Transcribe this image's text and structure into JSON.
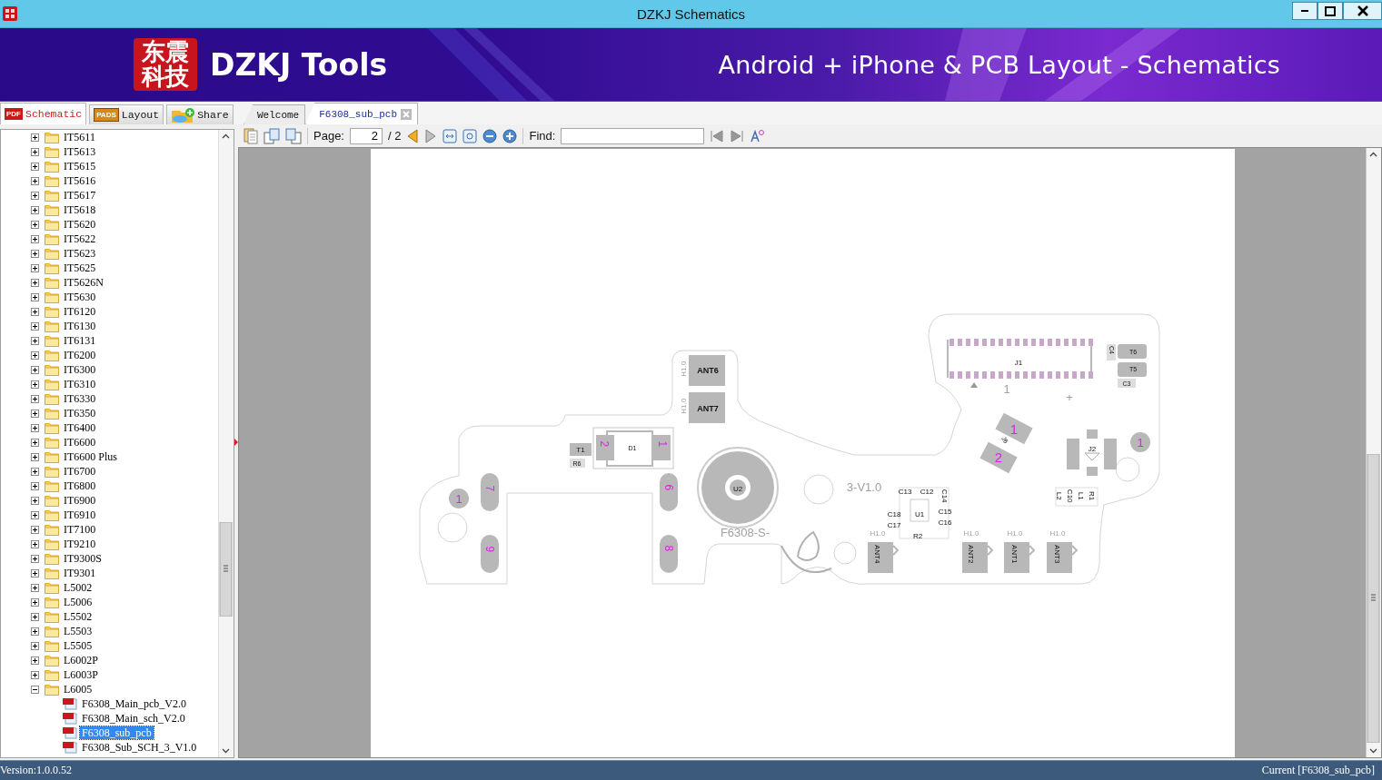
{
  "window": {
    "title": "DZKJ Schematics"
  },
  "banner": {
    "logo_text": "东震科技",
    "title": "DZKJ Tools",
    "tagline": "Android + iPhone & PCB Layout - Schematics"
  },
  "side_tabs": [
    {
      "label": "Schematic",
      "icon_text": "PDF",
      "selected": true
    },
    {
      "label": "Layout",
      "icon_text": "PADS",
      "selected": false
    },
    {
      "label": "Share",
      "selected": false
    }
  ],
  "tree": {
    "items": [
      {
        "label": "IT5611",
        "expanded": false
      },
      {
        "label": "IT5613",
        "expanded": false
      },
      {
        "label": "IT5615",
        "expanded": false
      },
      {
        "label": "IT5616",
        "expanded": false
      },
      {
        "label": "IT5617",
        "expanded": false
      },
      {
        "label": "IT5618",
        "expanded": false
      },
      {
        "label": "IT5620",
        "expanded": false
      },
      {
        "label": "IT5622",
        "expanded": false
      },
      {
        "label": "IT5623",
        "expanded": false
      },
      {
        "label": "IT5625",
        "expanded": false
      },
      {
        "label": "IT5626N",
        "expanded": false
      },
      {
        "label": "IT5630",
        "expanded": false
      },
      {
        "label": "IT6120",
        "expanded": false
      },
      {
        "label": "IT6130",
        "expanded": false
      },
      {
        "label": "IT6131",
        "expanded": false
      },
      {
        "label": "IT6200",
        "expanded": false
      },
      {
        "label": "IT6300",
        "expanded": false
      },
      {
        "label": "IT6310",
        "expanded": false
      },
      {
        "label": "IT6330",
        "expanded": false
      },
      {
        "label": "IT6350",
        "expanded": false
      },
      {
        "label": "IT6400",
        "expanded": false
      },
      {
        "label": "IT6600",
        "expanded": false
      },
      {
        "label": "IT6600 Plus",
        "expanded": false
      },
      {
        "label": "IT6700",
        "expanded": false
      },
      {
        "label": "IT6800",
        "expanded": false
      },
      {
        "label": "IT6900",
        "expanded": false
      },
      {
        "label": "IT6910",
        "expanded": false
      },
      {
        "label": "IT7100",
        "expanded": false
      },
      {
        "label": "IT9210",
        "expanded": false
      },
      {
        "label": "IT9300S",
        "expanded": false
      },
      {
        "label": "IT9301",
        "expanded": false
      },
      {
        "label": "L5002",
        "expanded": false
      },
      {
        "label": "L5006",
        "expanded": false
      },
      {
        "label": "L5502",
        "expanded": false
      },
      {
        "label": "L5503",
        "expanded": false
      },
      {
        "label": "L5505",
        "expanded": false
      },
      {
        "label": "L6002P",
        "expanded": false
      },
      {
        "label": "L6003P",
        "expanded": false
      },
      {
        "label": "L6005",
        "expanded": true,
        "children": [
          {
            "label": "F6308_Main_pcb_V2.0",
            "selected": false
          },
          {
            "label": "F6308_Main_sch_V2.0",
            "selected": false
          },
          {
            "label": "F6308_sub_pcb",
            "selected": true
          },
          {
            "label": "F6308_Sub_SCH_3_V1.0",
            "selected": false
          }
        ]
      }
    ]
  },
  "doc_tabs": [
    {
      "label": "Welcome",
      "selected": false
    },
    {
      "label": "F6308_sub_pcb",
      "selected": true
    }
  ],
  "toolbar": {
    "page_label": "Page:",
    "page_value": "2",
    "page_total": "/ 2",
    "find_label": "Find:"
  },
  "pcb_labels": [
    "H1.0",
    "ANT6",
    "H1.0",
    "ANT7",
    "D1",
    "2",
    "1",
    "T1",
    "R6",
    "1",
    "7",
    "9",
    "6",
    "8",
    "U2",
    "F6308-S-",
    "3-V1.0",
    "J1",
    "1",
    "+",
    "C4",
    "T6",
    "T5",
    "C3",
    "1",
    "2",
    "J6",
    "J2",
    "1",
    "C13",
    "C12",
    "C14",
    "C15",
    "C16",
    "C18",
    "C17",
    "U1",
    "R2",
    "L2",
    "C10",
    "L1",
    "R1",
    "H1.0",
    "ANT4",
    "H1.0",
    "ANT2",
    "H1.0",
    "ANT1",
    "H1.0",
    "ANT3"
  ],
  "status_bar": {
    "version": "Version:1.0.0.52",
    "current": "Current [F6308_sub_pcb]"
  }
}
